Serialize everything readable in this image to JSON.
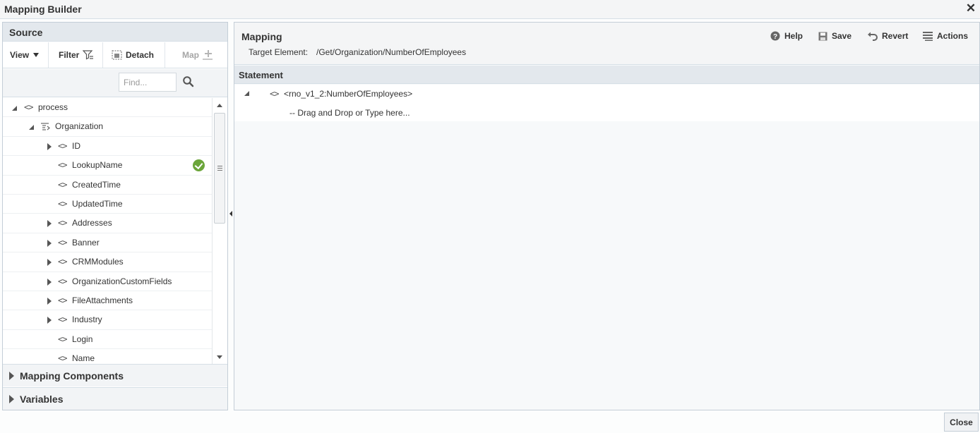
{
  "window": {
    "title": "Mapping Builder",
    "close_icon": "close-icon"
  },
  "source": {
    "header": "Source",
    "toolbar": {
      "view_label": "View",
      "filter_label": "Filter",
      "detach_label": "Detach",
      "map_label": "Map"
    },
    "find_placeholder": "Find...",
    "tree": [
      {
        "label": "process",
        "state": "expanded",
        "icon": "element-icon"
      },
      {
        "label": "Organization",
        "state": "expanded",
        "icon": "collection-icon"
      },
      {
        "label": "ID",
        "state": "collapsed",
        "icon": "element-icon"
      },
      {
        "label": "LookupName",
        "state": "leaf",
        "icon": "element-icon",
        "mapped": true
      },
      {
        "label": "CreatedTime",
        "state": "leaf",
        "icon": "element-icon"
      },
      {
        "label": "UpdatedTime",
        "state": "leaf",
        "icon": "element-icon"
      },
      {
        "label": "Addresses",
        "state": "collapsed",
        "icon": "element-icon"
      },
      {
        "label": "Banner",
        "state": "collapsed",
        "icon": "element-icon"
      },
      {
        "label": "CRMModules",
        "state": "collapsed",
        "icon": "element-icon"
      },
      {
        "label": "OrganizationCustomFields",
        "state": "collapsed",
        "icon": "element-icon"
      },
      {
        "label": "FileAttachments",
        "state": "collapsed",
        "icon": "element-icon"
      },
      {
        "label": "Industry",
        "state": "collapsed",
        "icon": "element-icon"
      },
      {
        "label": "Login",
        "state": "leaf",
        "icon": "element-icon"
      },
      {
        "label": "Name",
        "state": "leaf",
        "icon": "element-icon"
      }
    ],
    "accordions": {
      "mapping_components": "Mapping Components",
      "variables": "Variables"
    }
  },
  "mapping": {
    "title": "Mapping",
    "target_label": "Target Element:",
    "target_value": "/Get/Organization/NumberOfEmployees",
    "actions": {
      "help": "Help",
      "save": "Save",
      "revert": "Revert",
      "actions": "Actions"
    },
    "statement": {
      "header": "Statement",
      "node": "<rno_v1_2:NumberOfEmployees>",
      "drop_hint": "-- Drag and Drop or Type here..."
    }
  },
  "footer": {
    "close_label": "Close"
  },
  "colors": {
    "mapped_check": "#6ba53a",
    "header_bg": "#e3e8ed",
    "panel_border": "#c4ced7"
  }
}
